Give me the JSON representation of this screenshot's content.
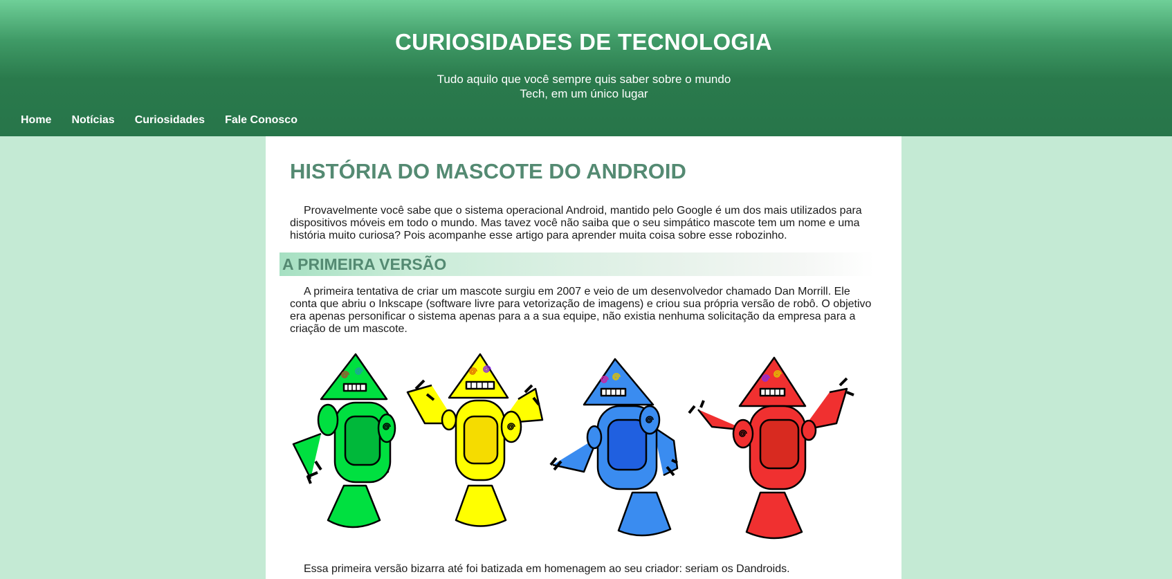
{
  "header": {
    "site_title": "CURIOSIDADES DE TECNOLOGIA",
    "tagline_line1": "Tudo aquilo que você sempre quis saber sobre o mundo",
    "tagline_line2": "Tech, em um único lugar"
  },
  "nav": {
    "items": [
      {
        "label": "Home"
      },
      {
        "label": "Notícias"
      },
      {
        "label": "Curiosidades"
      },
      {
        "label": "Fale Conosco"
      }
    ]
  },
  "article": {
    "title": "HISTÓRIA DO MASCOTE DO ANDROID",
    "intro": "Provavelmente você sabe que o sistema operacional Android, mantido pelo Google é um dos mais utilizados para dispositivos móveis em todo o mundo. Mas tavez você não saiba que o seu simpático mascote tem um nome e uma história muito curiosa? Pois acompanhe esse artigo para aprender muita coisa sobre esse robozinho.",
    "section_heading": "A PRIMEIRA VERSÃO",
    "section_text": "A primeira tentativa de criar um mascote surgiu em 2007 e veio de um desenvolvedor chamado Dan Morrill. Ele conta que abriu o Inkscape (software livre para vetorização de imagens) e criou sua própria versão de robô. O objetivo era apenas personificar o sistema apenas para a a sua equipe, não existia nenhuma solicitação da empresa para a criação de um mascote.",
    "closing_text": "Essa primeira versão bizarra até foi batizada em homenagem ao seu criador: seriam os Dandroids."
  },
  "robots": [
    {
      "name": "green-robot",
      "color": "#00e040",
      "body": "#00b83a"
    },
    {
      "name": "yellow-robot",
      "color": "#ffff00",
      "body": "#f5dc00"
    },
    {
      "name": "blue-robot",
      "color": "#3a8cf0",
      "body": "#2060e0"
    },
    {
      "name": "red-robot",
      "color": "#f03030",
      "body": "#d82a20"
    }
  ]
}
